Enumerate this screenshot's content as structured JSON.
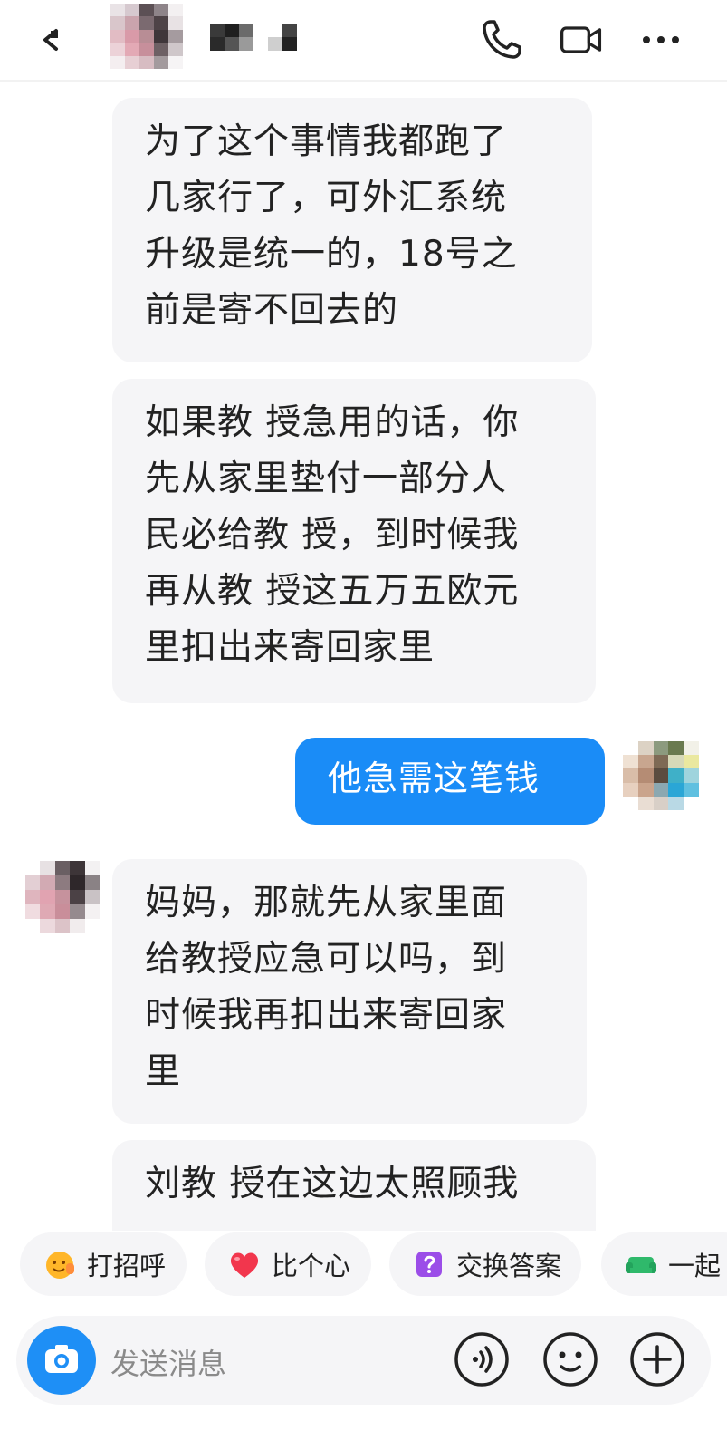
{
  "header": {
    "back_icon": "back-arrow-icon",
    "call_icon": "phone-icon",
    "video_icon": "video-camera-icon",
    "more_icon": "more-dots-icon"
  },
  "messages": [
    {
      "side": "left",
      "text": "为了这个事情我都跑了\n几家行了，可外汇系统\n升级是统一的，18号之\n前是寄不回去的"
    },
    {
      "side": "left",
      "text": "如果教 授急用的话，你\n先从家里垫付一部分人\n民必给教 授，到时候我\n再从教 授这五万五欧元\n里扣出来寄回家里"
    },
    {
      "side": "right",
      "text": "他急需这笔钱"
    },
    {
      "side": "left",
      "text": "妈妈，那就先从家里面\n给教授应急可以吗，到\n时候我再扣出来寄回家\n里"
    },
    {
      "side": "left",
      "text": "刘教 授在这边太照顾我"
    }
  ],
  "quick_actions": [
    {
      "label": "打招呼",
      "icon": "wave-emoji-icon"
    },
    {
      "label": "比个心",
      "icon": "heart-icon"
    },
    {
      "label": "交换答案",
      "icon": "question-box-icon"
    },
    {
      "label": "一起",
      "icon": "sofa-icon"
    }
  ],
  "composer": {
    "placeholder": "发送消息",
    "camera_icon": "camera-icon",
    "voice_icon": "voice-icon",
    "emoji_icon": "emoji-icon",
    "plus_icon": "plus-icon"
  },
  "colors": {
    "accent": "#1a8cf7",
    "bubble_bg": "#f5f5f7"
  }
}
